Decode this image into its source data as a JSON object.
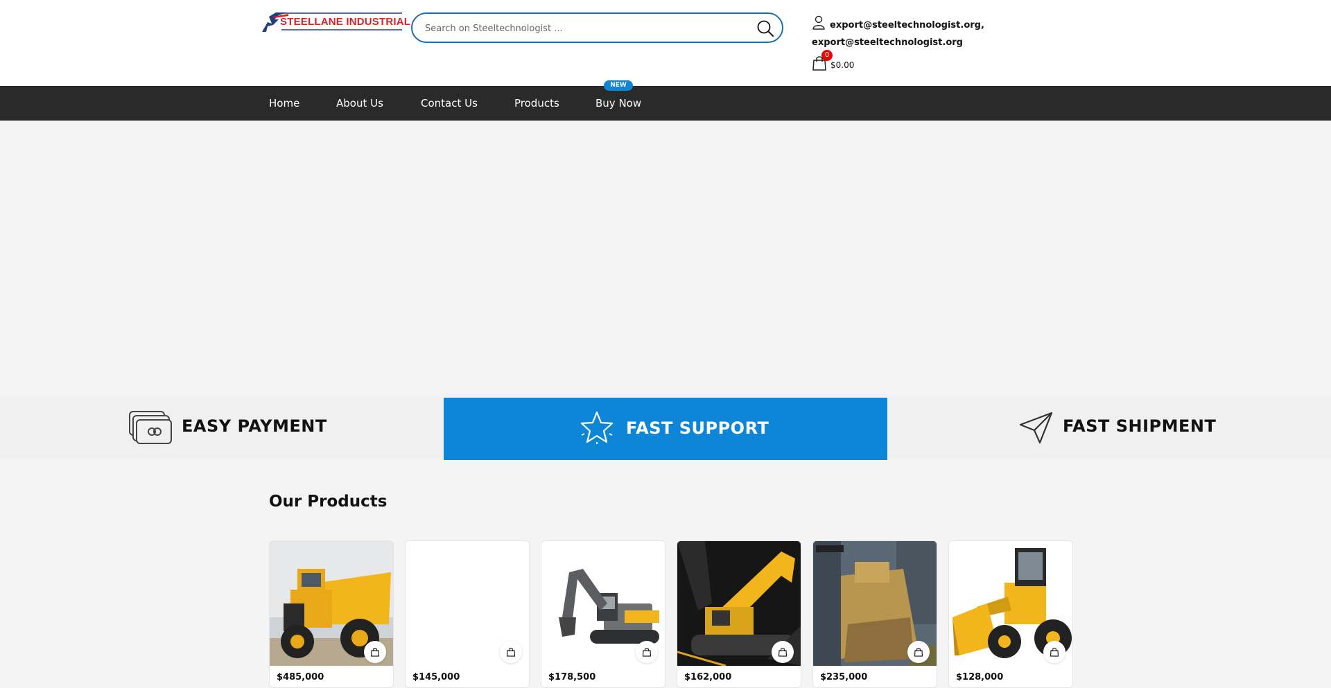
{
  "header": {
    "logo_text": "STEELLANE INDUSTRIAL",
    "search": {
      "placeholder": "Search on Steeltechnologist ..."
    },
    "account": {
      "email_line_1": "export@steeltechnologist.org,",
      "email_line_2": "export@steeltechnologist.org"
    },
    "cart": {
      "count": "0",
      "total": "$0.00"
    }
  },
  "nav": {
    "items": [
      {
        "label": "Home"
      },
      {
        "label": "About Us"
      },
      {
        "label": "Contact Us"
      },
      {
        "label": "Products"
      },
      {
        "label": "Buy Now"
      }
    ],
    "badge": "NEW"
  },
  "features": [
    {
      "label": "EASY PAYMENT",
      "icon": "money-icon"
    },
    {
      "label": "FAST SUPPORT",
      "icon": "star-icon"
    },
    {
      "label": "FAST SHIPMENT",
      "icon": "paper-plane-icon"
    }
  ],
  "products_section": {
    "title": "Our Products",
    "items": [
      {
        "price": "$485,000",
        "image": "dump-truck"
      },
      {
        "price": "$145,000",
        "image": "blank"
      },
      {
        "price": "$178,500",
        "image": "excavator-grey"
      },
      {
        "price": "$162,000",
        "image": "excavator-dark"
      },
      {
        "price": "$235,000",
        "image": "dozer"
      },
      {
        "price": "$128,000",
        "image": "wheel-loader"
      }
    ]
  },
  "colors": {
    "accent": "#0d86d8",
    "nav_bg": "#2a2a2a",
    "search_border": "#1a6fa8",
    "logo_red": "#d8232a",
    "machine_yellow": "#f2b51c"
  }
}
